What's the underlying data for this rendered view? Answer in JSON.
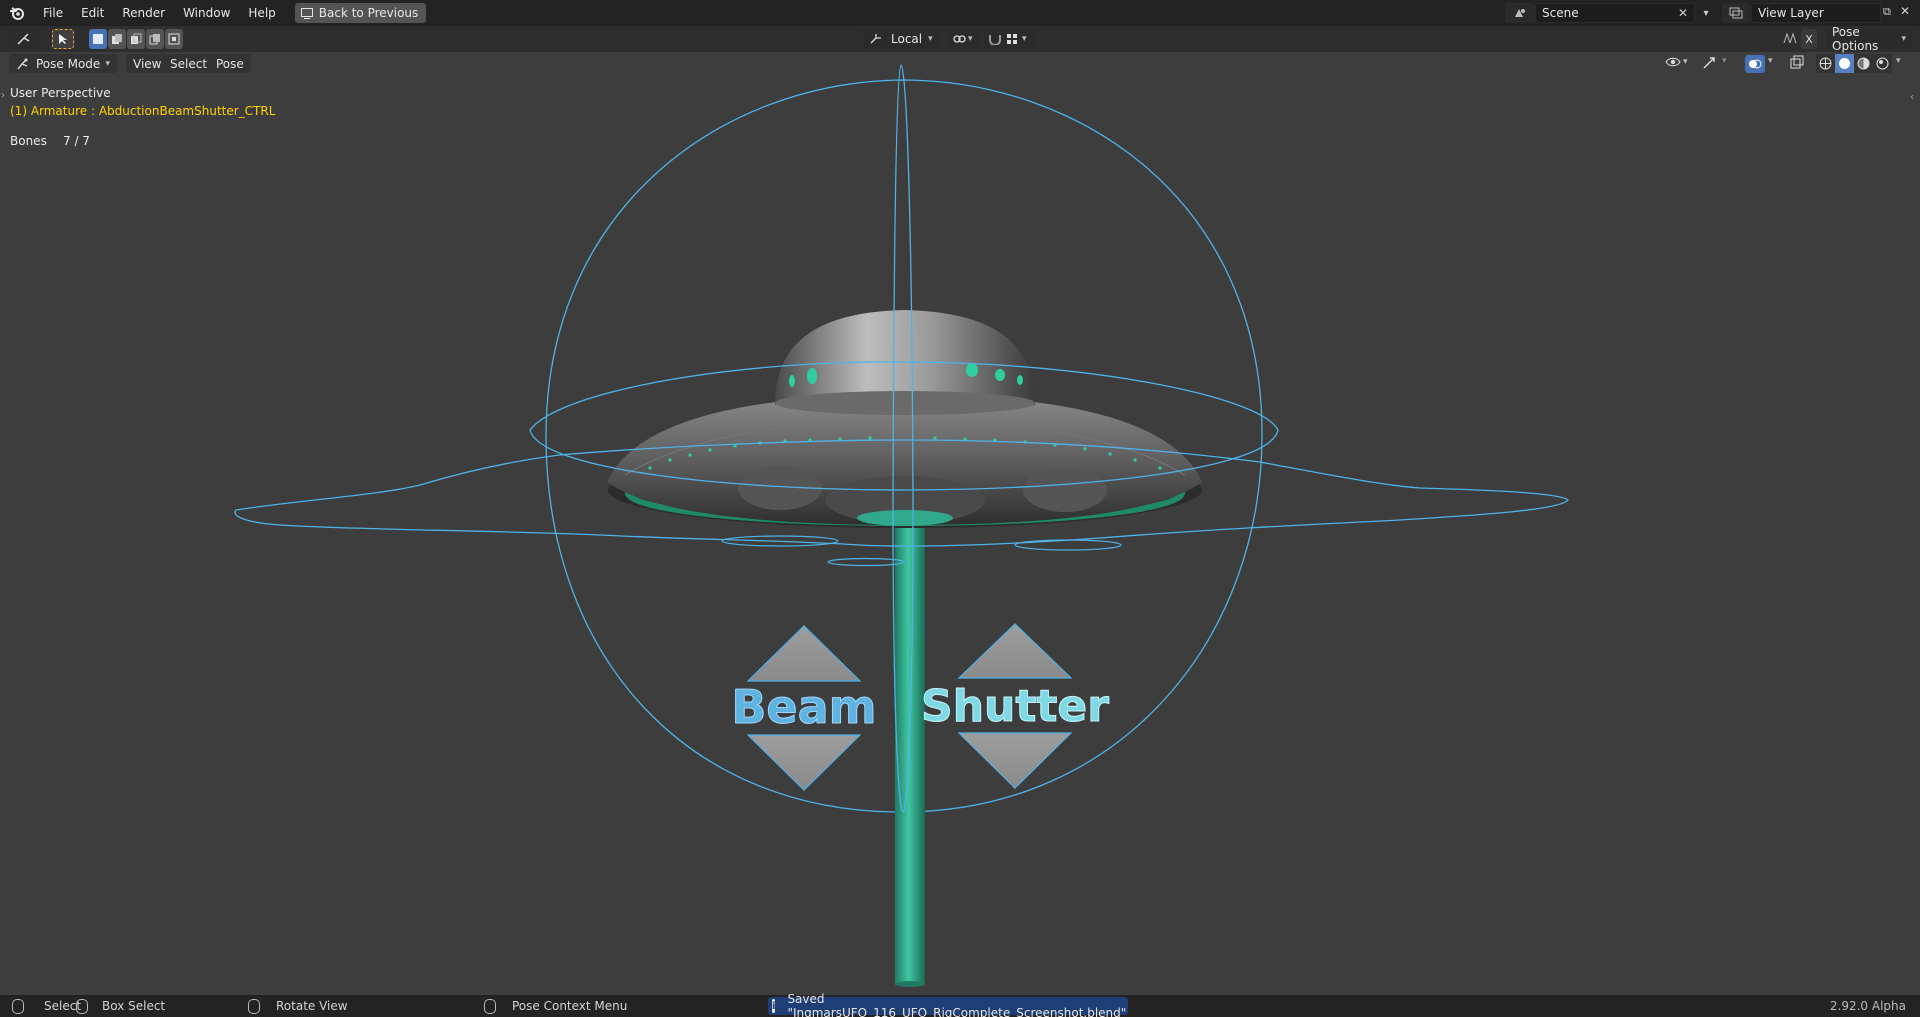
{
  "topbar": {
    "menus": [
      "File",
      "Edit",
      "Render",
      "Window",
      "Help"
    ],
    "back_label": "Back to Previous",
    "scene_name": "Scene",
    "view_layer": "View Layer"
  },
  "toolbar": {
    "transform_orientation": "Local",
    "pose_options": "Pose Options"
  },
  "viewport_header": {
    "mode": "Pose Mode",
    "menus": [
      "View",
      "Select",
      "Pose"
    ]
  },
  "viewport": {
    "perspective": "User Perspective",
    "active_object": "(1) Armature : AbductionBeamShutter_CTRL",
    "bones_label": "Bones",
    "bones_count": "7 / 7",
    "labels": {
      "beam": "Beam",
      "shutter": "Shutter"
    }
  },
  "statusbar": {
    "select": "Select",
    "box_select": "Box Select",
    "rotate_view": "Rotate View",
    "context_menu": "Pose Context Menu",
    "saved_message": "Saved \"IngmarsUFO_116_UFO_RigComplete_Screenshot.blend\"",
    "version": "2.92.0 Alpha"
  },
  "colors": {
    "viewport_bg": "#3d3d3d",
    "bone_wire": "#4fb3e8",
    "beam_green": "#2fa98a",
    "armature_label": "#ffd200",
    "saved_bg": "#1f3e76"
  }
}
